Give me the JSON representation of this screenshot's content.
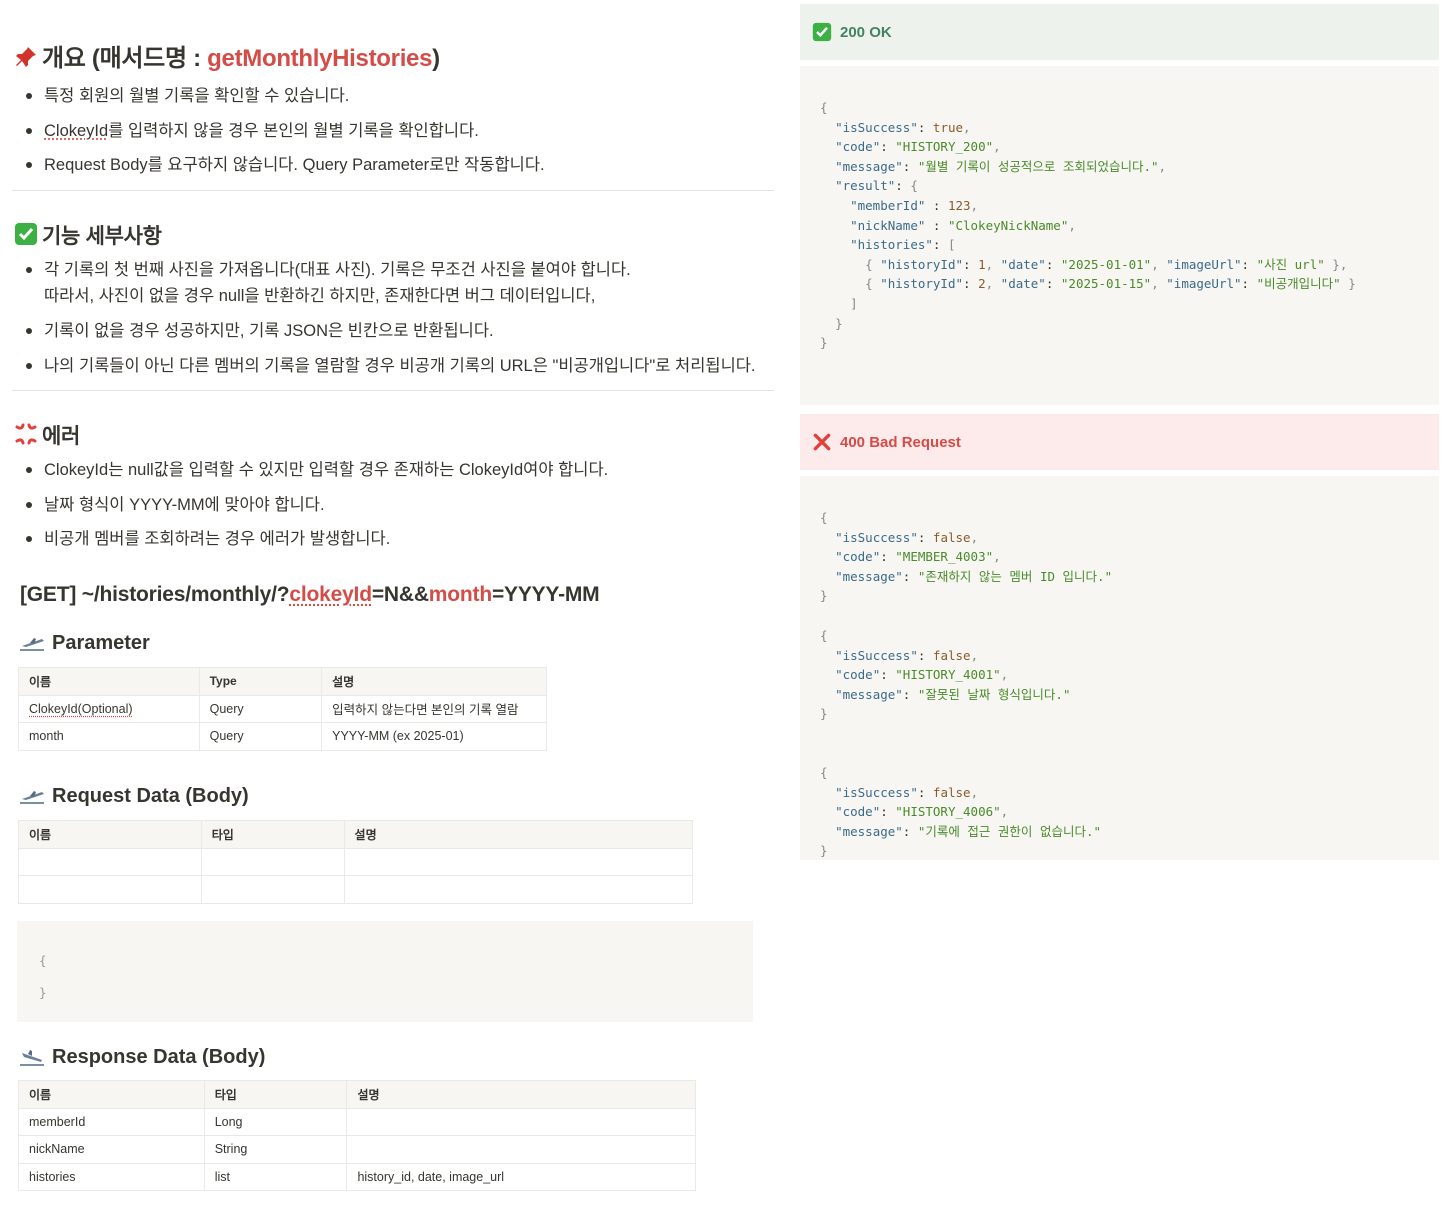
{
  "overview": {
    "title_prefix": "개요 (매서드명 : ",
    "method_name": "getMonthlyHistories",
    "title_suffix": ")",
    "icon": "pushpin-icon",
    "bullets": [
      "특정 회원의 월별 기록을 확인할 수 있습니다.",
      "ClokeyId를 입력하지 않을 경우 본인의 월별 기록을 확인합니다.",
      "Request Body를 요구하지 않습니다. Query Parameter로만 작동합니다."
    ]
  },
  "features": {
    "title": "기능 세부사항",
    "icon": "check-mark-icon",
    "bullets": [
      {
        "line1": "각 기록의 첫 번째 사진을 가져옵니다(대표 사진). 기록은 무조건 사진을 붙여야 합니다.",
        "line2": "따라서, 사진이 없을 경우 null을 반환하긴 하지만, 존재한다면 버그 데이터입니다,"
      },
      {
        "line1": "기록이 없을 경우 성공하지만, 기록 JSON은 빈칸으로 반환됩니다."
      },
      {
        "line1": "나의 기록들이 아닌 다른 멤버의 기록을 열람할 경우 비공개 기록의 URL은 \"비공개입니다\"로 처리됩니다."
      }
    ]
  },
  "errors": {
    "title": "에러",
    "icon": "anger-symbol-icon",
    "bullets": [
      "ClokeyId는 null값을 입력할 수 있지만 입력할 경우 존재하는 ClokeyId여야 합니다.",
      "날짜 형식이 YYYY-MM에 맞아야 합니다.",
      "비공개 멤버를 조회하려는 경우 에러가 발생합니다."
    ]
  },
  "endpoint": {
    "prefix": "[GET] ~/histories/monthly/?",
    "param1": "clokeyId",
    "mid": "=N&&",
    "param2": "month",
    "suffix": "=YYYY-MM"
  },
  "parameter": {
    "title": "Parameter",
    "headers": [
      "이름",
      "Type",
      "설명"
    ],
    "rows": [
      [
        "ClokeyId(Optional)",
        "Query",
        "입력하지 않는다면 본인의 기록 열람"
      ],
      [
        "month",
        "Query",
        "YYYY-MM  (ex 2025-01)"
      ]
    ]
  },
  "request": {
    "title": "Request Data (Body)",
    "headers": [
      "이름",
      "타입",
      "설명"
    ],
    "code_open": "{",
    "code_close": "}"
  },
  "response": {
    "title": "Response Data (Body)",
    "headers": [
      "이름",
      "타입",
      "설명"
    ],
    "rows": [
      [
        "memberId",
        "Long",
        ""
      ],
      [
        "nickName",
        "String",
        ""
      ],
      [
        "histories",
        "list",
        "history_id, date, image_url"
      ]
    ]
  },
  "ok": {
    "label": "200 OK",
    "code": [
      "{",
      "  \"isSuccess\": true,",
      "  \"code\": \"HISTORY_200\",",
      "  \"message\": \"월별 기록이 성공적으로 조회되었습니다.\",",
      "  \"result\": {",
      "    \"memberId\" : 123,",
      "    \"nickName\" : \"ClokeyNickName\",",
      "    \"histories\": [",
      "      { \"historyId\": 1, \"date\": \"2025-01-01\", \"imageUrl\": \"사진 url\" },",
      "      { \"historyId\": 2, \"date\": \"2025-01-15\", \"imageUrl\": \"비공개입니다\" }",
      "    ]",
      "  }",
      "}"
    ]
  },
  "bad": {
    "label": "400 Bad Request",
    "blocks": [
      [
        "{",
        "  \"isSuccess\": false,",
        "  \"code\": \"MEMBER_4003\",",
        "  \"message\": \"존재하지 않는 멤버 ID 입니다.\"",
        "}"
      ],
      [
        "{",
        "  \"isSuccess\": false,",
        "  \"code\": \"HISTORY_4001\",",
        "  \"message\": \"잘못된 날짜 형식입니다.\"",
        "}"
      ],
      [
        "{",
        "  \"isSuccess\": false,",
        "  \"code\": \"HISTORY_4006\",",
        "  \"message\": \"기록에 접근 권한이 없습니다.\"",
        "}"
      ]
    ]
  }
}
